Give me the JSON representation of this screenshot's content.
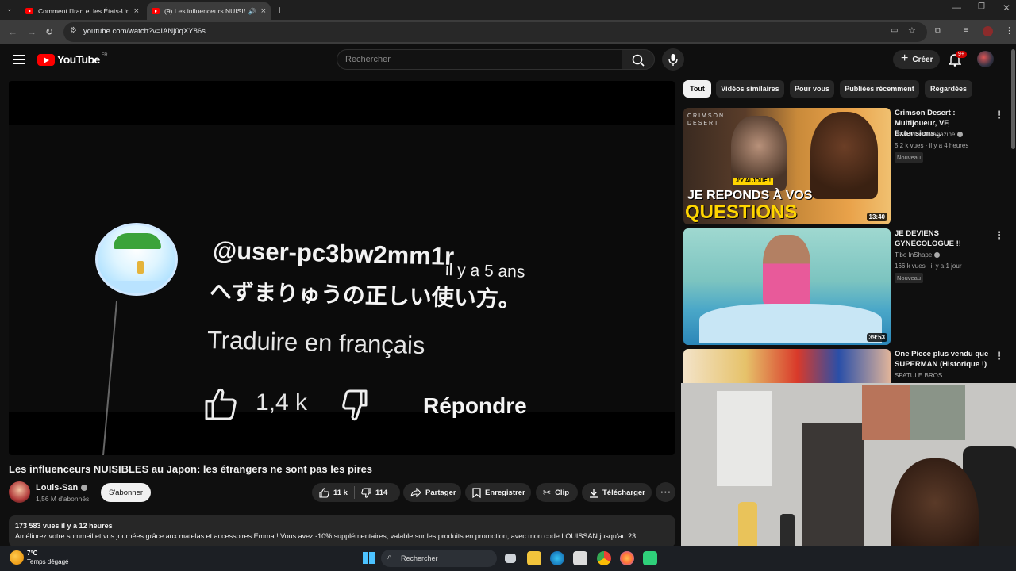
{
  "browser": {
    "tabs": [
      {
        "title": "Comment l'Iran et les États-Uni",
        "active": false
      },
      {
        "title": "(9) Les influenceurs NUISIBLE",
        "active": true
      }
    ],
    "url": "youtube.com/watch?v=IANj0qXY86s"
  },
  "header": {
    "logo": "YouTube",
    "country_code": "FR",
    "search_placeholder": "Rechercher",
    "create_label": "Créer",
    "notification_badge": "9+"
  },
  "player": {
    "comment_user": "@user-pc3bw2mm1r",
    "comment_age": "il y a 5 ans",
    "comment_text": "へずまりゅうの正しい使い方。",
    "translate_label": "Traduire en français",
    "comment_likes": "1,4 k",
    "reply_label": "Répondre"
  },
  "video": {
    "title": "Les influenceurs NUISIBLES au Japon: les étrangers ne sont pas les pires",
    "channel": "Louis-San",
    "subscribers": "1,56 M d'abonnés",
    "subscribe_label": "S'abonner",
    "likes": "11 k",
    "dislikes": "114",
    "share_label": "Partager",
    "save_label": "Enregistrer",
    "clip_label": "Clip",
    "download_label": "Télécharger",
    "stats": "173 583 vues  il y a 12 heures",
    "description": "Améliorez votre sommeil et vos journées grâce aux matelas et accessoires Emma ! Vous avez -10% supplémentaires, valable sur les produits en promotion, avec mon code LOUISSAN jusqu'au 23"
  },
  "chips": [
    "Tout",
    "Vidéos similaires",
    "Pour vous",
    "Publiées récemment",
    "Regardées"
  ],
  "recommendations": [
    {
      "title": "Crimson Desert : Multijoueur, VF, Extensions...",
      "channel": "Jeux Vidéo Magazine",
      "meta": "5,2 k vues · il y a 4 heures",
      "badge": "Nouveau",
      "duration": "13:40",
      "thumb_brand": "CRIMSON DESERT",
      "thumb_tag": "J'Y AI JOUÉ !",
      "thumb_line1": "JE REPONDS À VOS",
      "thumb_line2": "QUESTIONS"
    },
    {
      "title": "JE DEVIENS GYNÉCOLOGUE !!",
      "channel": "Tibo InShape",
      "meta": "166 k vues · il y a 1 jour",
      "badge": "Nouveau",
      "duration": "39:53"
    },
    {
      "title": "One Piece plus vendu que SUPERMAN (Historique !)",
      "channel": "SPATULE BROS",
      "meta": "",
      "badge": "",
      "duration": ""
    }
  ],
  "taskbar": {
    "temperature": "7°C",
    "condition": "Temps dégagé",
    "search_label": "Rechercher"
  }
}
